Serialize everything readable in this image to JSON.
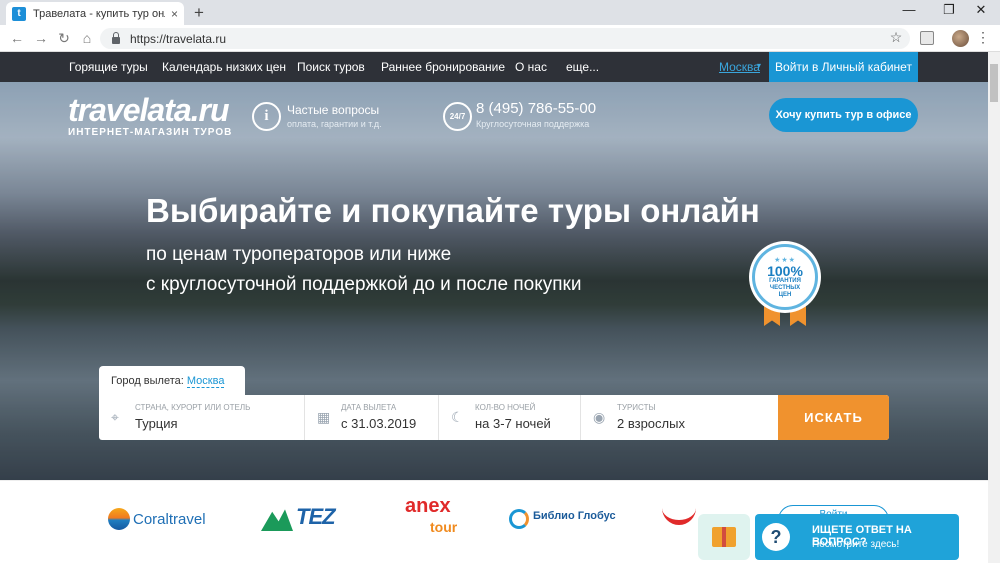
{
  "browser": {
    "tab_title": "Травелата - купить тур онлайн",
    "tab_close": "×",
    "new_tab": "+",
    "favicon_letter": "t",
    "url": "https://travelata.ru",
    "back": "←",
    "forward": "→",
    "reload": "↻",
    "home": "⌂",
    "bookmark_star": "☆",
    "menu": "⋮",
    "minimize": "—",
    "maximize": "❐",
    "close": "✕"
  },
  "sitenav": {
    "links": [
      "Горящие туры",
      "Календарь низких цен",
      "Поиск туров",
      "Раннее бронирование",
      "О нас",
      "еще..."
    ],
    "city": "Москва",
    "city_caret": "▾",
    "login": "Войти в Личный кабинет"
  },
  "header": {
    "logo_main": "travelata.ru",
    "logo_sub": "ИНТЕРНЕТ-МАГАЗИН ТУРОВ",
    "faq_icon": "i",
    "faq_title": "Частые вопросы",
    "faq_sub": "оплата, гарантии и т.д.",
    "phone_icon": "24/7",
    "phone": "8 (495) 786-55-00",
    "phone_sub": "Круглосуточная поддержка",
    "office_btn": "Хочу купить тур в офисе"
  },
  "hero": {
    "headline": "Выбирайте и покупайте туры онлайн",
    "sub1": "по ценам туроператоров или ниже",
    "sub2": "с круглосуточной поддержкой до и после покупки",
    "badge_stars": "★★★",
    "badge_percent": "100%",
    "badge_text_1": "ГАРАНТИЯ",
    "badge_text_2": "ЧЕСТНЫХ",
    "badge_text_3": "ЦЕН"
  },
  "search": {
    "departure_label": "Город вылета:",
    "departure_value": "Москва",
    "fields": [
      {
        "icon": "⌖",
        "label": "СТРАНА, КУРОРТ ИЛИ ОТЕЛЬ",
        "value": "Турция"
      },
      {
        "icon": "▦",
        "label": "ДАТА ВЫЛЕТА",
        "value": "с 31.03.2019"
      },
      {
        "icon": "☾",
        "label": "КОЛ-ВО НОЧЕЙ",
        "value": "на 3-7 ночей"
      },
      {
        "icon": "◉",
        "label": "ТУРИСТЫ",
        "value": "2 взрослых"
      }
    ],
    "button": "ИСКАТЬ"
  },
  "partners": {
    "coral": "Coraltravel",
    "tez": "TEZ",
    "anex": "anex",
    "anex_sub": "tour",
    "biblio": "Библио Глобус",
    "more_label": "Войти"
  },
  "widgets": {
    "chat_icon": "?",
    "chat_title": "ИЩЕТЕ ОТВЕТ НА ВОПРОС?",
    "chat_sub": "Посмотрите здесь!"
  }
}
